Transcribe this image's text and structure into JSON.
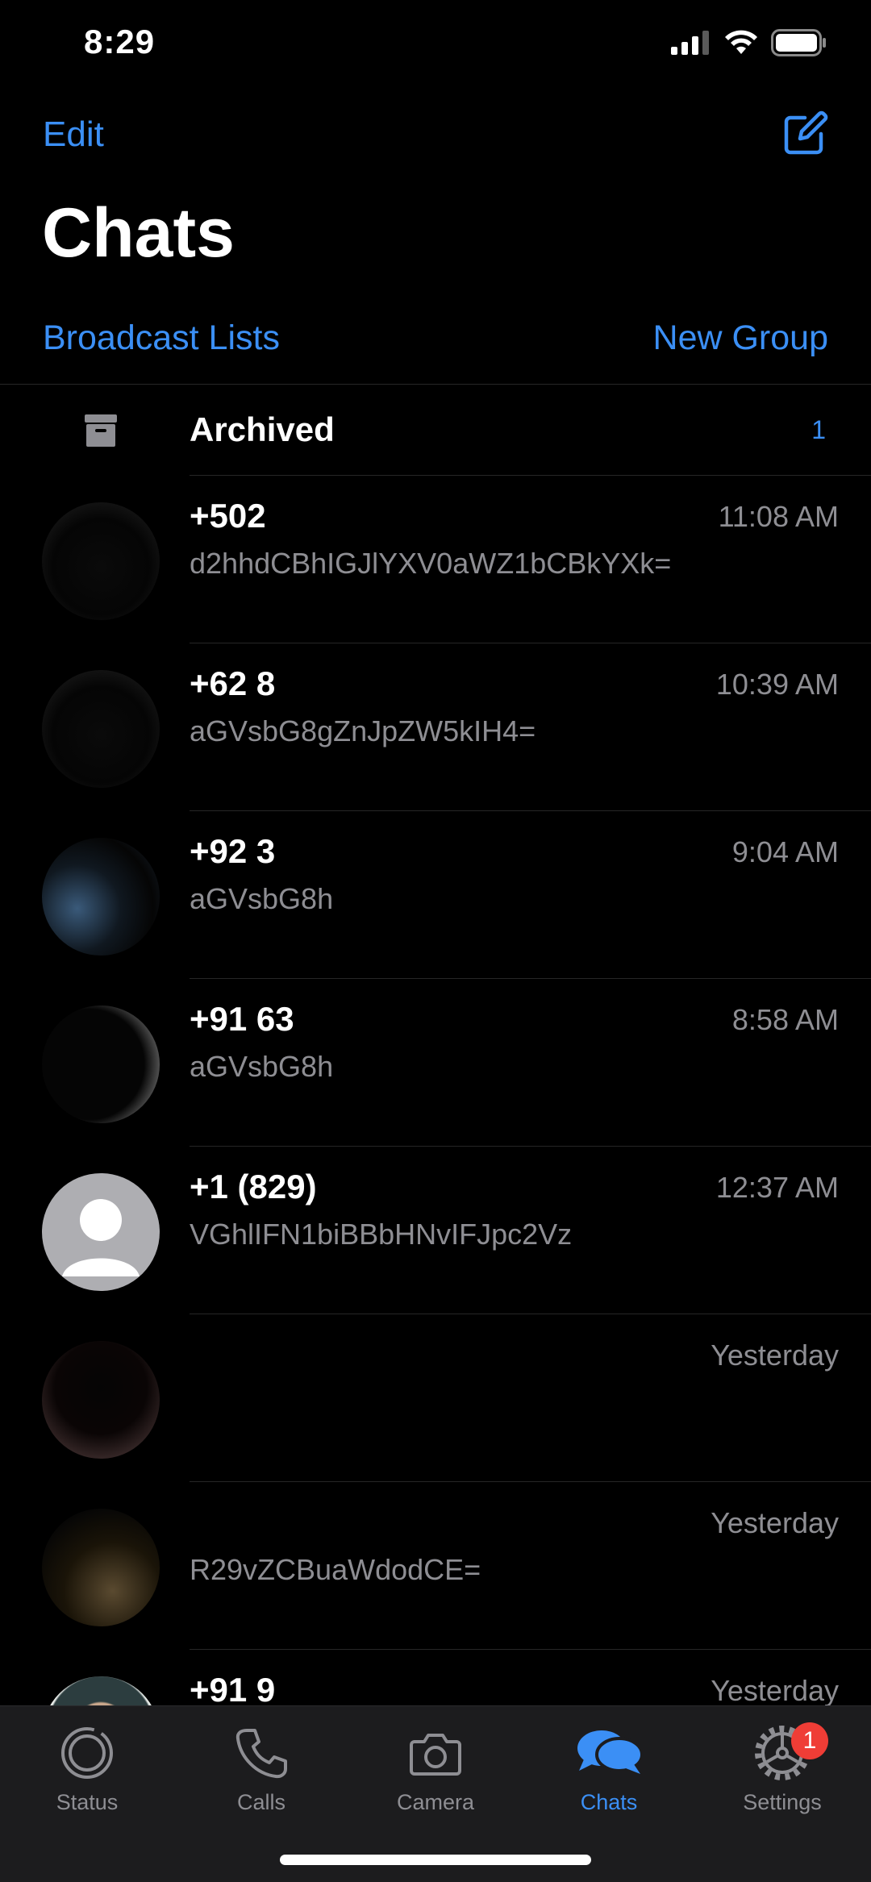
{
  "status_bar": {
    "time": "8:29"
  },
  "nav": {
    "edit_label": "Edit",
    "title": "Chats",
    "broadcast_label": "Broadcast Lists",
    "new_group_label": "New Group"
  },
  "archived": {
    "label": "Archived",
    "count": "1"
  },
  "chats": [
    {
      "name": "+502",
      "time": "11:08 AM",
      "message": "d2hhdCBhIGJlYXV0aWZ1bCBkYXk="
    },
    {
      "name": "+62 8",
      "time": "10:39 AM",
      "message": "aGVsbG8gZnJpZW5kIH4="
    },
    {
      "name": "+92 3",
      "time": "9:04 AM",
      "message": "aGVsbG8h"
    },
    {
      "name": "+91 63",
      "time": "8:58 AM",
      "message": "aGVsbG8h"
    },
    {
      "name": "+1 (829)",
      "time": "12:37 AM",
      "message": "VGhlIFN1biBBbHNvIFJpc2Vz"
    },
    {
      "name": "",
      "time": "Yesterday",
      "message": ""
    },
    {
      "name": "",
      "time": "Yesterday",
      "message": "R29vZCBuaWdodCE="
    },
    {
      "name": "+91 9",
      "time": "Yesterday",
      "message": ""
    }
  ],
  "tabs": [
    {
      "label": "Status",
      "icon": "status-icon"
    },
    {
      "label": "Calls",
      "icon": "phone-icon"
    },
    {
      "label": "Camera",
      "icon": "camera-icon"
    },
    {
      "label": "Chats",
      "icon": "chat-bubbles-icon",
      "active": true
    },
    {
      "label": "Settings",
      "icon": "gear-icon",
      "badge": "1"
    }
  ],
  "colors": {
    "accent": "#3b8ff5",
    "badge": "#ef3d36",
    "secondary_text": "#8e8e93",
    "tab_bar": "#1c1c1e"
  }
}
